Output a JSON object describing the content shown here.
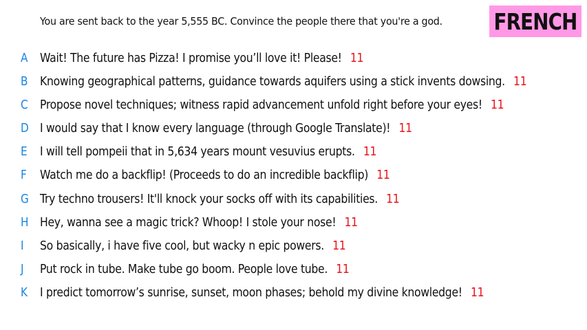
{
  "prompt": "You are sent back to the year 5,555 BC. Convince the people there that you're a god.",
  "badge": {
    "label": "FRENCH",
    "color": "#ff99e6"
  },
  "colors": {
    "letter": "#1a86e0",
    "score": "#e8141b"
  },
  "answers": [
    {
      "letter": "A",
      "text": "Wait! The future has Pizza! I promise you’ll love it! Please!",
      "score": "11"
    },
    {
      "letter": "B",
      "text": "Knowing geographical patterns, guidance towards aquifers using a stick invents dowsing.",
      "score": "11"
    },
    {
      "letter": "C",
      "text": "Propose novel techniques; witness rapid advancement unfold right before your eyes!",
      "score": "11"
    },
    {
      "letter": "D",
      "text": "I would say that I know every language (through Google Translate)!",
      "score": "11"
    },
    {
      "letter": "E",
      "text": "I will tell pompeii that in 5,634 years mount vesuvius erupts.",
      "score": "11"
    },
    {
      "letter": "F",
      "text": "Watch me do a backflip! (Proceeds to do an incredible backflip)",
      "score": "11"
    },
    {
      "letter": "G",
      "text": "Try techno trousers! It'll knock your socks off with its capabilities.",
      "score": "11"
    },
    {
      "letter": "H",
      "text": "Hey, wanna see a magic trick? Whoop! I stole your nose!",
      "score": "11"
    },
    {
      "letter": "I",
      "text": "So basically, i have five cool, but wacky n epic powers.",
      "score": "11"
    },
    {
      "letter": "J",
      "text": "Put rock in tube. Make tube go boom. People love tube.",
      "score": "11"
    },
    {
      "letter": "K",
      "text": "I predict tomorrow’s sunrise, sunset, moon phases; behold my divine knowledge!",
      "score": "11"
    }
  ]
}
